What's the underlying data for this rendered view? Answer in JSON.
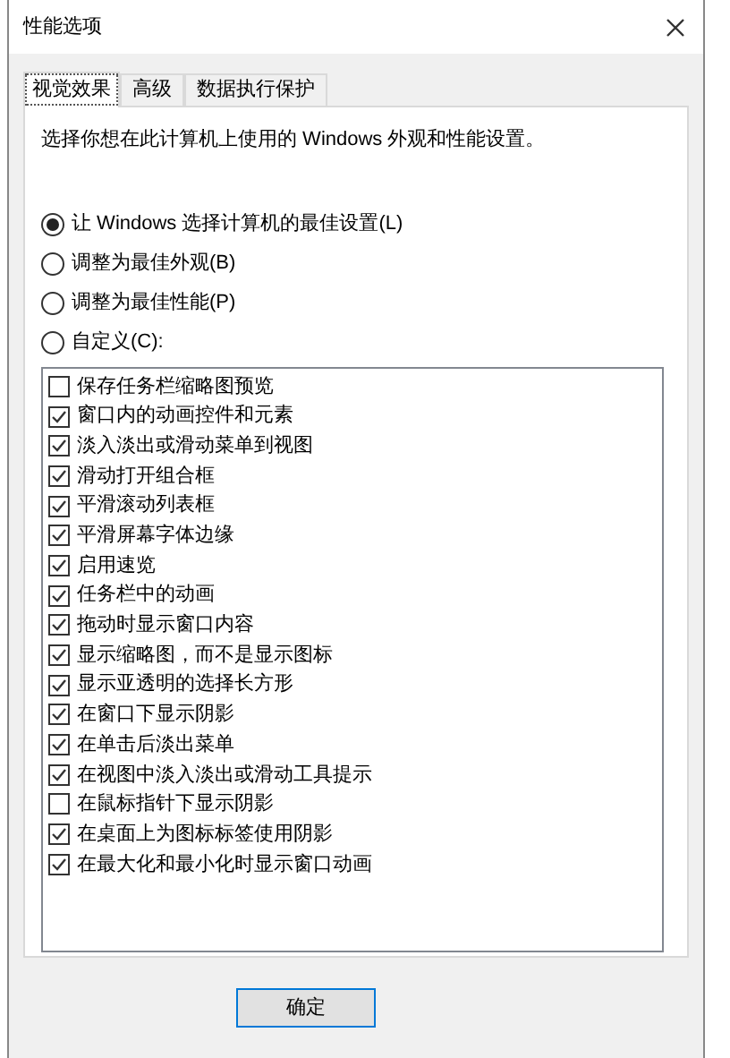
{
  "window": {
    "title": "性能选项"
  },
  "tabs": [
    {
      "label": "视觉效果",
      "selected": true
    },
    {
      "label": "高级",
      "selected": false
    },
    {
      "label": "数据执行保护",
      "selected": false
    }
  ],
  "description": "选择你想在此计算机上使用的 Windows 外观和性能设置。",
  "options": [
    {
      "label": "让 Windows 选择计算机的最佳设置(L)",
      "selected": true
    },
    {
      "label": "调整为最佳外观(B)",
      "selected": false
    },
    {
      "label": "调整为最佳性能(P)",
      "selected": false
    },
    {
      "label": "自定义(C):",
      "selected": false
    }
  ],
  "effects": [
    {
      "label": "保存任务栏缩略图预览",
      "checked": false
    },
    {
      "label": "窗口内的动画控件和元素",
      "checked": true
    },
    {
      "label": "淡入淡出或滑动菜单到视图",
      "checked": true
    },
    {
      "label": "滑动打开组合框",
      "checked": true
    },
    {
      "label": "平滑滚动列表框",
      "checked": true
    },
    {
      "label": "平滑屏幕字体边缘",
      "checked": true
    },
    {
      "label": "启用速览",
      "checked": true
    },
    {
      "label": "任务栏中的动画",
      "checked": true
    },
    {
      "label": "拖动时显示窗口内容",
      "checked": true
    },
    {
      "label": "显示缩略图，而不是显示图标",
      "checked": true
    },
    {
      "label": "显示亚透明的选择长方形",
      "checked": true
    },
    {
      "label": "在窗口下显示阴影",
      "checked": true
    },
    {
      "label": "在单击后淡出菜单",
      "checked": true
    },
    {
      "label": "在视图中淡入淡出或滑动工具提示",
      "checked": true
    },
    {
      "label": "在鼠标指针下显示阴影",
      "checked": false
    },
    {
      "label": "在桌面上为图标标签使用阴影",
      "checked": true
    },
    {
      "label": "在最大化和最小化时显示窗口动画",
      "checked": true
    }
  ],
  "buttons": [
    "确定"
  ]
}
